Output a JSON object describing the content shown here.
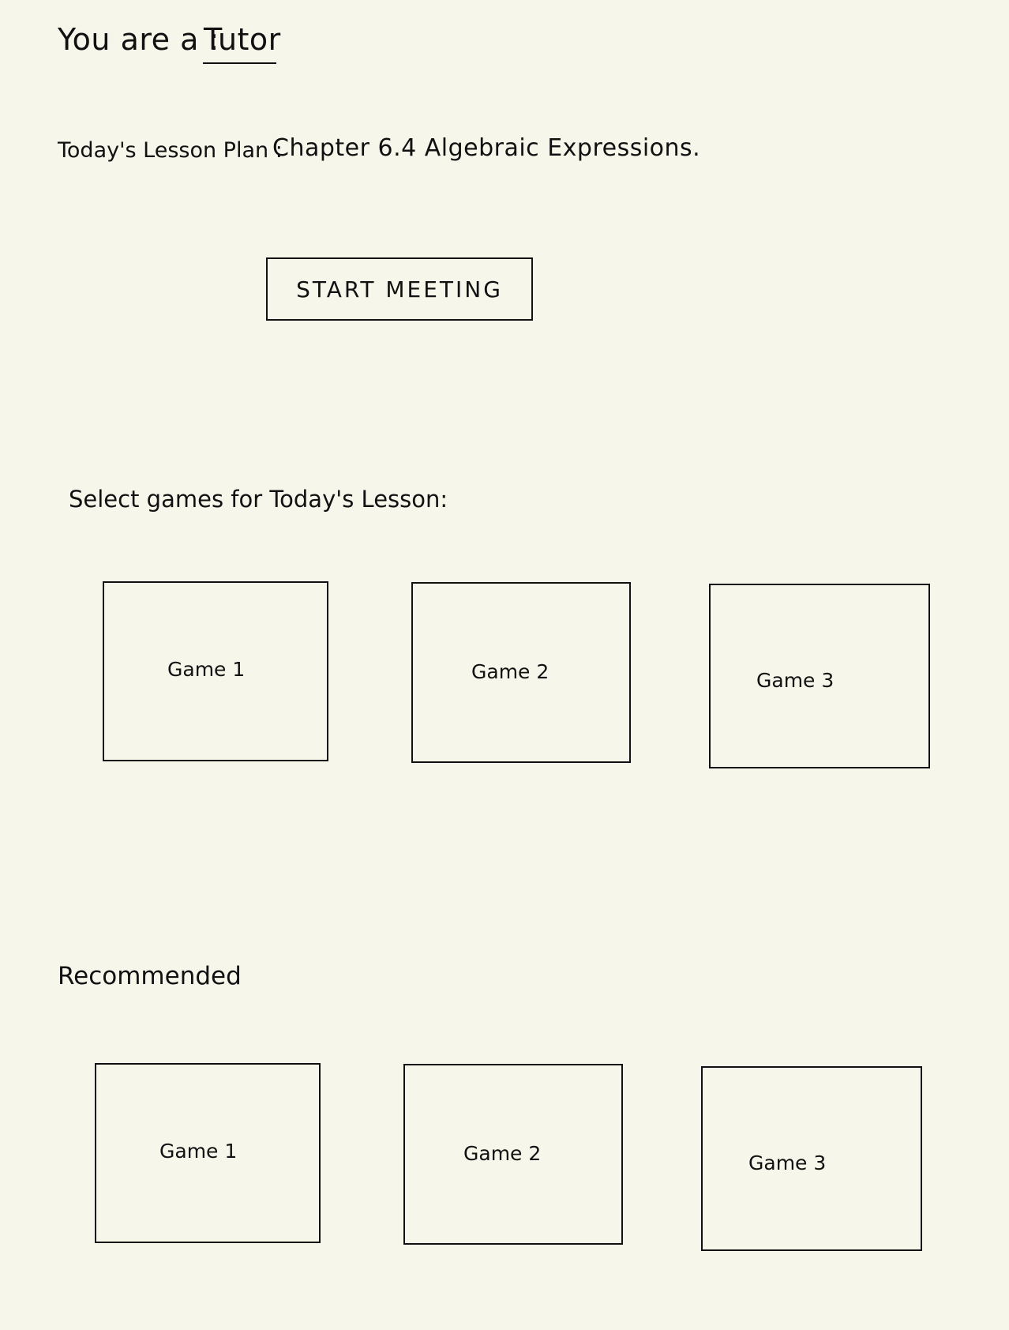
{
  "role": {
    "label": "You are a :",
    "value": "Tutor"
  },
  "lesson": {
    "label": "Today's Lesson Plan :",
    "value": "Chapter 6.4  Algebraic Expressions."
  },
  "start_button": {
    "label": "START  MEETING"
  },
  "select_section": {
    "heading": "Select games for Today's Lesson:",
    "games": [
      {
        "label": "Game 1"
      },
      {
        "label": "Game 2"
      },
      {
        "label": "Game 3"
      }
    ]
  },
  "recommended_section": {
    "heading": "Recommended",
    "games": [
      {
        "label": "Game 1"
      },
      {
        "label": "Game 2"
      },
      {
        "label": "Game 3"
      }
    ]
  }
}
